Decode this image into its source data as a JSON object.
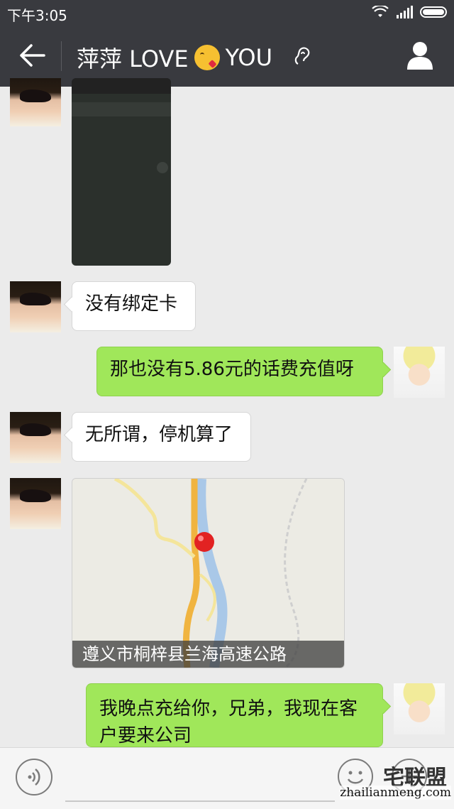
{
  "status_bar": {
    "time": "下午3:05"
  },
  "header": {
    "title": "萍萍  LOVE",
    "title_suffix": "YOU",
    "emoji": "kissing-face-emoji"
  },
  "messages": [
    {
      "side": "left",
      "type": "image"
    },
    {
      "side": "left",
      "type": "text",
      "text": "没有绑定卡"
    },
    {
      "side": "right",
      "type": "text",
      "text": "那也没有5.86元的话费充值呀"
    },
    {
      "side": "left",
      "type": "text",
      "text": "无所谓，停机算了"
    },
    {
      "side": "left",
      "type": "location",
      "text": "遵义市桐梓县兰海高速公路"
    },
    {
      "side": "right",
      "type": "text",
      "text": "我晚点充给你，兄弟，我现在客户要来公司"
    }
  ],
  "watermark": {
    "brand": "宅联盟",
    "url": "zhailianmeng.com"
  },
  "colors": {
    "header_bg": "#393a3f",
    "chat_bg": "#ebebeb",
    "sent_bubble": "#a0e75a",
    "received_bubble": "#ffffff"
  }
}
